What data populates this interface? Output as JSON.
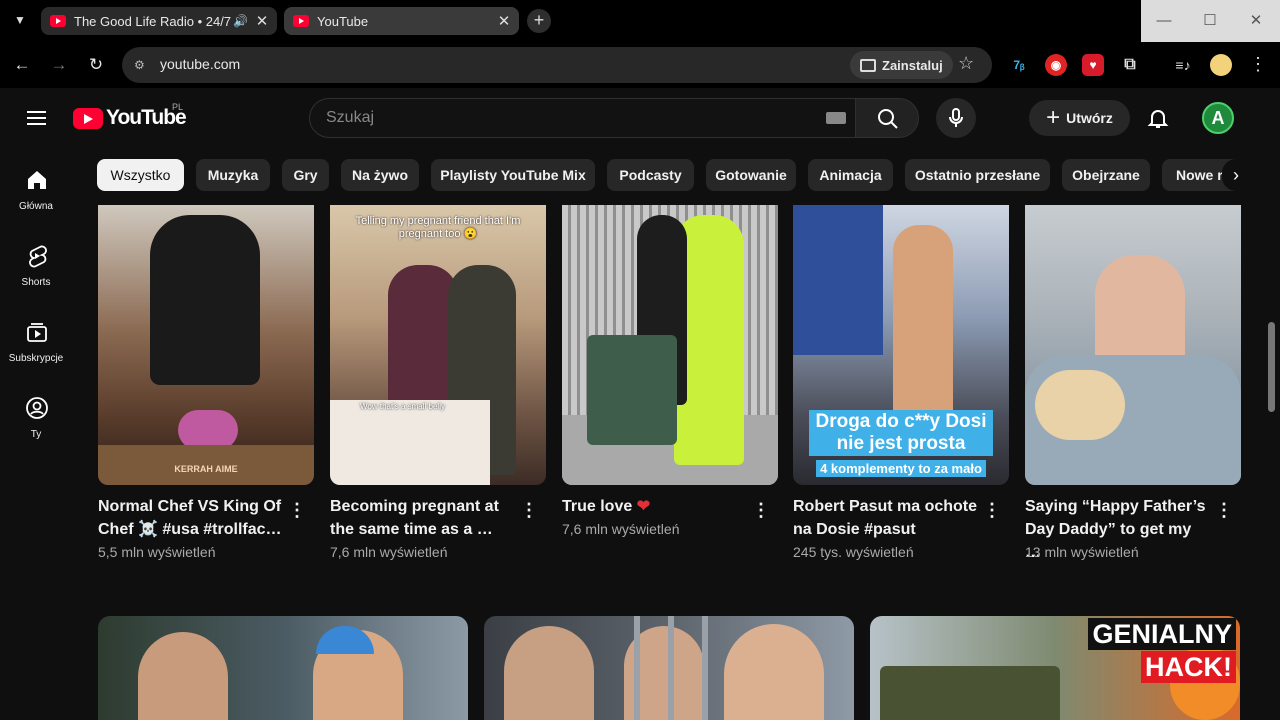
{
  "browser": {
    "tabs": [
      {
        "title": "The Good Life Radio • 24/7",
        "audio": true,
        "active": false
      },
      {
        "title": "YouTube",
        "audio": false,
        "active": true
      }
    ],
    "url": "youtube.com",
    "install_label": "Zainstaluj"
  },
  "youtube": {
    "logo_text": "YouTube",
    "country_code": "PL",
    "search_placeholder": "Szukaj",
    "create_label": "Utwórz",
    "avatar_letter": "A",
    "sidebar": [
      {
        "label": "Główna",
        "icon": "home-icon"
      },
      {
        "label": "Shorts",
        "icon": "shorts-icon"
      },
      {
        "label": "Subskrypcje",
        "icon": "subscriptions-icon"
      },
      {
        "label": "Ty",
        "icon": "you-icon"
      }
    ],
    "chips": [
      "Wszystko",
      "Muzyka",
      "Gry",
      "Na żywo",
      "Playlisty YouTube Mix",
      "Podcasty",
      "Gotowanie",
      "Animacja",
      "Ostatnio przesłane",
      "Obejrzane",
      "Nowe r"
    ],
    "selected_chip": "Wszystko",
    "shorts": [
      {
        "title": "Normal Chef VS King Of Chef ☠️ #usa #trollfac…",
        "views": "5,5 mln wyświetleń",
        "overlay_text": "",
        "thumb_text": "KERRAH AIME"
      },
      {
        "title": "Becoming pregnant at the same time as a …",
        "views": "7,6 mln wyświetleń",
        "overlay_text": "Telling my pregnant friend that I'm pregnant too 😮",
        "thumb_text": "Wow that's a small belly"
      },
      {
        "title": "True love",
        "views": "7,6 mln wyświetleń",
        "overlay_text": "",
        "thumb_text": ""
      },
      {
        "title": "Robert Pasut ma ochote na Dosie #pasut",
        "views": "245 tys. wyświetleń",
        "overlay_text": "Droga do c**y Dosi nie jest prosta",
        "overlay_sub": "4 komplementy to za mało"
      },
      {
        "title": "Saying “Happy Father’s Day Daddy” to get my …",
        "views": "13 mln wyświetleń",
        "overlay_text": ""
      }
    ],
    "bottom_videos": [
      {
        "thumb_text": ""
      },
      {
        "thumb_text": ""
      },
      {
        "thumb_text_1": "GENIALNY",
        "thumb_text_2": "HACK!"
      }
    ]
  },
  "colors": {
    "background": "#0f0f0f",
    "brand_red": "#ff0033",
    "chip_bg": "#272727",
    "caption_blue": "#3fb0e8"
  }
}
